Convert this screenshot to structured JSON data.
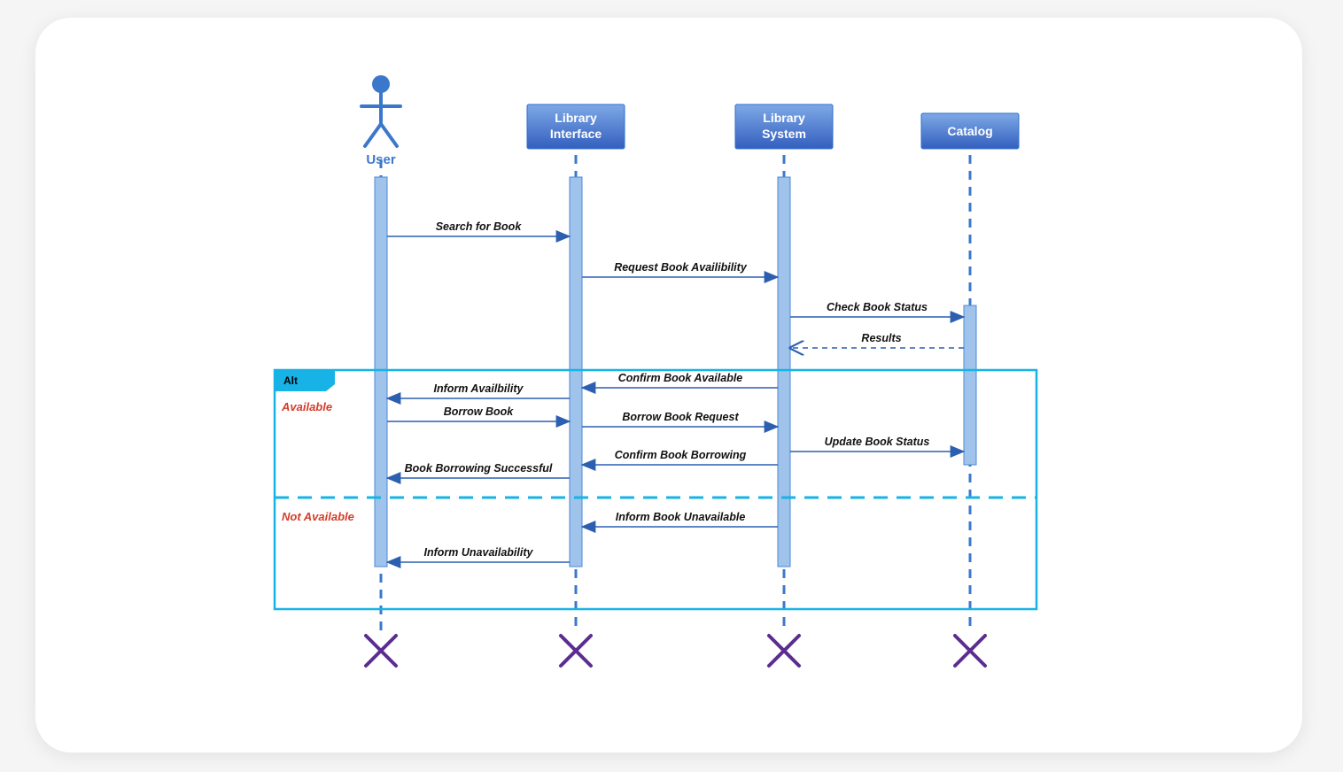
{
  "participants": {
    "user": "User",
    "library_interface_l1": "Library",
    "library_interface_l2": "Interface",
    "library_system_l1": "Library",
    "library_system_l2": "System",
    "catalog": "Catalog"
  },
  "messages": {
    "m1": "Search for Book",
    "m2": "Request Book Availibility",
    "m3": "Check Book Status",
    "m4": "Results",
    "m5": "Confirm Book Available",
    "m6": "Inform Availbility",
    "m7": "Borrow Book",
    "m8": "Borrow Book Request",
    "m9": "Update Book Status",
    "m10": "Confirm Book Borrowing",
    "m11": "Book Borrowing Successful",
    "m12": "Inform Book Unavailable",
    "m13": "Inform Unavailability"
  },
  "fragment": {
    "label": "Alt",
    "guard_available": "Available",
    "guard_not_available": "Not Available"
  }
}
